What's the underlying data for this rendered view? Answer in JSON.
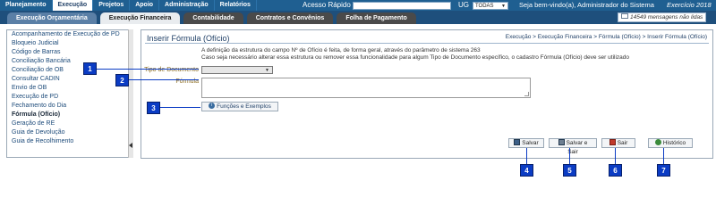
{
  "menu": [
    "Planejamento",
    "Execução",
    "Projetos",
    "Apoio",
    "Administração",
    "Relatórios"
  ],
  "quick_access_label": "Acesso Rápido",
  "ug_label": "UG",
  "ug_value": "TODAS",
  "welcome": "Seja bem-vindo(a), Administrador do Sistema",
  "exercise": "Exercício 2018",
  "subtabs": [
    "Execução Orçamentária",
    "Execução Financeira",
    "Contabilidade",
    "Contratos e Convênios",
    "Folha de Pagamento"
  ],
  "messages": "14549 mensagens não lidas",
  "sidebar": [
    "Acompanhamento de Execução de PD",
    "Bloqueio Judicial",
    "Código de Barras",
    "Conciliação Bancária",
    "Conciliação de OB",
    "Consultar CADIN",
    "Envio de OB",
    "Execução de PD",
    "Fechamento do Dia",
    "Fórmula (Ofício)",
    "Geração de RE",
    "Guia de Devolução",
    "Guia de Recolhimento"
  ],
  "page": {
    "title": "Inserir Fórmula (Ofício)",
    "breadcrumb": "Execução > Execução Financeira > Fórmula (Ofício) > Inserir Fórmula (Ofício)",
    "info1": "A definição da estrutura do campo Nº de Ofício é feita, de forma geral, através do parâmetro de sistema 263",
    "info2": "Caso seja necessário alterar essa estrutura ou remover essa funcionalidade para algum Tipo de Documento específico, o cadastro Fórmula (Ofício) deve ser utilizado",
    "tipo_label": "Tipo de Documento",
    "formula_label": "Fórmula",
    "functions_button": "Funções e Exemplos",
    "save": "Salvar",
    "save_exit": "Salvar e Sair",
    "exit": "Sair",
    "history": "Histórico"
  },
  "callouts": [
    "1",
    "2",
    "3",
    "4",
    "5",
    "6",
    "7"
  ],
  "colors": {
    "callout": "#0b3cc4",
    "topbar": "#1f5f91"
  }
}
